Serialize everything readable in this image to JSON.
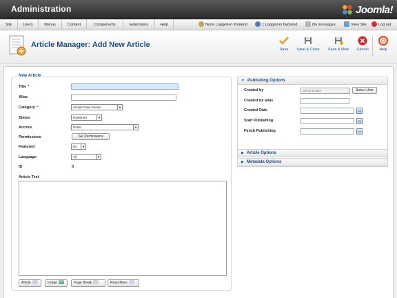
{
  "header": {
    "title": "Administration",
    "brand": "Joomla!"
  },
  "menu": [
    "Site",
    "Users",
    "Menus",
    "Content",
    "Components",
    "Extensions",
    "Help"
  ],
  "status": {
    "frontend": "None Logged-in frontend",
    "backend": "1 Logged-in backend",
    "messages": "No messages",
    "view_site": "View Site",
    "logout": "Log out"
  },
  "toolbar": {
    "title": "Article Manager: Add New Article",
    "buttons": [
      {
        "label": "Save",
        "icon": "save-icon"
      },
      {
        "label": "Save & Close",
        "icon": "save-close-icon"
      },
      {
        "label": "Save & New",
        "icon": "save-new-icon"
      },
      {
        "label": "Cancel",
        "icon": "cancel-icon"
      },
      {
        "label": "Help",
        "icon": "help-icon"
      }
    ]
  },
  "form": {
    "legend": "New Article",
    "title_label": "Title",
    "title_value": "",
    "alias_label": "Alias",
    "alias_value": "",
    "category_label": "Category",
    "category_value": "Simple Data Articles",
    "status_label": "Status",
    "status_value": "Published",
    "access_label": "Access",
    "access_value": "Public",
    "permissions_label": "Permissions",
    "permissions_button": "Set Permissions",
    "featured_label": "Featured",
    "featured_value": "No",
    "language_label": "Language",
    "language_value": "All",
    "id_label": "ID",
    "id_value": "0",
    "article_text_label": "Article Text",
    "editor_buttons": [
      "Article",
      "Image",
      "Page Break",
      "Read More"
    ]
  },
  "publishing": {
    "title": "Publishing Options",
    "created_by_label": "Created by",
    "created_by_placeholder": "Select a User",
    "select_user_button": "Select User",
    "created_by_alias_label": "Created by alias",
    "created_date_label": "Created Date",
    "start_publishing_label": "Start Publishing",
    "finish_publishing_label": "Finish Publishing",
    "calendar_icon_text": "23"
  },
  "panels": {
    "article_options": "Article Options",
    "metadata_options": "Metadata Options"
  },
  "colors": {
    "accent": "#164c8c",
    "required": "#dd0000",
    "save": "#e8a020",
    "cancel": "#d42020",
    "help": "#e85020"
  }
}
